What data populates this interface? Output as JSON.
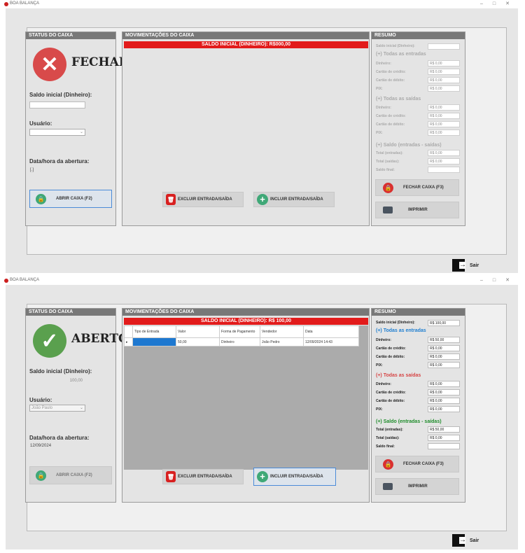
{
  "app": {
    "title": "BOA BALANÇA",
    "window_buttons": [
      "–",
      "□",
      "✕"
    ]
  },
  "colors": {
    "header": "#787878",
    "red_bar": "#e21b1b",
    "closed": "#d84a4a",
    "open": "#5aa04e",
    "blue": "#1e7ed0",
    "green": "#1e8c2a"
  },
  "screens": [
    {
      "status": {
        "header": "STATUS DO CAIXA",
        "state": "FECHADO",
        "state_icon": "x-icon",
        "saldo_label": "Saldo inicial (Dinheiro):",
        "saldo_value": "",
        "usuario_label": "Usuário:",
        "usuario_value": "",
        "data_label": "Data/hora da abertura:",
        "data_value": "[.]",
        "abrir_label": "ABRIR CAIXA (F2)"
      },
      "mov": {
        "header": "MOVIMENTAÇÕES DO CAIXA",
        "banner": "SALDO INICIAL (DINHEIRO): R$000,00",
        "excluir_label": "EXCLUIR ENTRADA/SAÍDA",
        "incluir_label": "INCLUIR ENTRADA/SAÍDA"
      },
      "res": {
        "header": "RESUMO",
        "saldo_inicial_label": "Saldo inicial (Dinheiro):",
        "saldo_inicial_value": "",
        "entradas_title": "(+) Todas as entradas",
        "entradas": [
          {
            "label": "Dinheiro:",
            "value": "R$ 0,00"
          },
          {
            "label": "Cartão de crédito:",
            "value": "R$ 0,00"
          },
          {
            "label": "Cartão de débito:",
            "value": "R$ 0,00"
          },
          {
            "label": "PIX:",
            "value": "R$ 0,00"
          }
        ],
        "saidas_title": "(+) Todas as saídas",
        "saidas": [
          {
            "label": "Dinheiro:",
            "value": "R$ 0,00"
          },
          {
            "label": "Cartão de crédito:",
            "value": "R$ 0,00"
          },
          {
            "label": "Cartão de débito:",
            "value": "R$ 0,00"
          },
          {
            "label": "PIX:",
            "value": "R$ 0,00"
          }
        ],
        "saldo_title": "(+) Saldo (entradas - saídas)",
        "totais": [
          {
            "label": "Total (entradas):",
            "value": "R$ 0,00"
          },
          {
            "label": "Total (saídas):",
            "value": "R$ 0,00"
          },
          {
            "label": "Saldo final:",
            "value": ""
          }
        ],
        "fechar_label": "FECHAR CAIXA (F3)",
        "imprimir_label": "IMPRIMIR"
      },
      "sair_label": "Sair"
    },
    {
      "status": {
        "header": "STATUS DO CAIXA",
        "state": "ABERTO",
        "state_icon": "check-icon",
        "saldo_label": "Saldo inicial (Dinheiro):",
        "saldo_value": "100,00",
        "usuario_label": "Usuário:",
        "usuario_value": "João Paulo",
        "data_label": "Data/hora da abertura:",
        "data_value": "12/09/2024",
        "abrir_label": "ABRIR CAIXA (F2)"
      },
      "mov": {
        "header": "MOVIMENTAÇÕES DO CAIXA",
        "banner": "SALDO INICIAL (DINHEIRO): R$ 100,00",
        "columns": [
          "Tipo de Entrada",
          "Valor",
          "Forma de Pagamento",
          "Vendedor",
          "Data"
        ],
        "rows": [
          {
            "tipo": "",
            "valor": "50,00",
            "forma": "Dinheiro",
            "vendedor": "João Pedro",
            "data": "12/09/2024 14:43"
          }
        ],
        "excluir_label": "EXCLUIR ENTRADA/SAÍDA",
        "incluir_label": "INCLUIR ENTRADA/SAÍDA"
      },
      "res": {
        "header": "RESUMO",
        "saldo_inicial_label": "Saldo inicial (Dinheiro):",
        "saldo_inicial_value": "R$ 100,00",
        "entradas_title": "(+) Todas as entradas",
        "entradas": [
          {
            "label": "Dinheiro:",
            "value": "R$ 50,00"
          },
          {
            "label": "Cartão de crédito:",
            "value": "R$ 0,00"
          },
          {
            "label": "Cartão de débito:",
            "value": "R$ 0,00"
          },
          {
            "label": "PIX:",
            "value": "R$ 0,00"
          }
        ],
        "saidas_title": "(+) Todas as saídas",
        "saidas": [
          {
            "label": "Dinheiro:",
            "value": "R$ 0,00"
          },
          {
            "label": "Cartão de crédito:",
            "value": "R$ 0,00"
          },
          {
            "label": "Cartão de débito:",
            "value": "R$ 0,00"
          },
          {
            "label": "PIX:",
            "value": "R$ 0,00"
          }
        ],
        "saldo_title": "(+) Saldo (entradas - saídas)",
        "totais": [
          {
            "label": "Total (entradas):",
            "value": "R$ 50,00"
          },
          {
            "label": "Total (saídas):",
            "value": "R$ 0,00"
          },
          {
            "label": "Saldo final:",
            "value": ""
          }
        ],
        "fechar_label": "FECHAR CAIXA (F3)",
        "imprimir_label": "IMPRIMIR"
      },
      "sair_label": "Sair"
    }
  ]
}
